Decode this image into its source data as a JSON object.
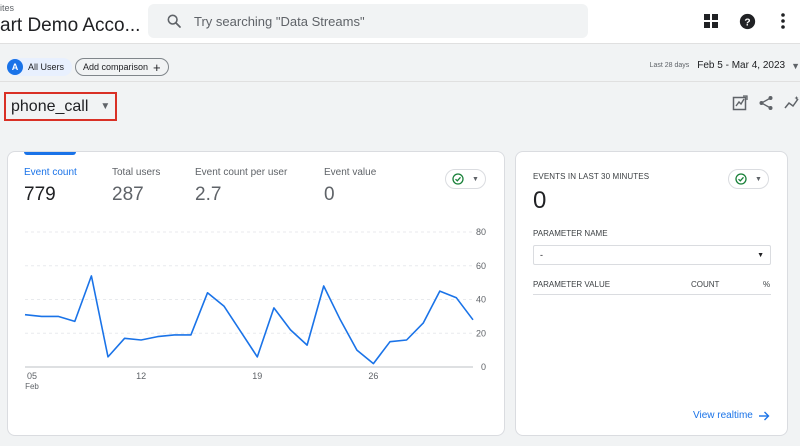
{
  "header": {
    "breadcrumb": "ites",
    "account": "art Demo Acco...",
    "search_placeholder": "Try searching \"Data Streams\"",
    "icons": [
      "apps-grid-icon",
      "help-icon",
      "more-vert-icon"
    ]
  },
  "comparison": {
    "avatar_letter": "A",
    "segment": "All Users",
    "add_label": "Add comparison",
    "date_caption": "Last 28 days",
    "date_range": "Feb 5 - Mar 4, 2023"
  },
  "event": {
    "name": "phone_call",
    "actions": [
      "customize-report-icon",
      "share-icon",
      "insights-icon"
    ]
  },
  "metrics": [
    {
      "label": "Event count",
      "value": "779"
    },
    {
      "label": "Total users",
      "value": "287"
    },
    {
      "label": "Event count per user",
      "value": "2.7"
    },
    {
      "label": "Event value",
      "value": "0"
    }
  ],
  "chart_data": {
    "type": "line",
    "title": "",
    "x_ticks": [
      "05",
      "12",
      "19",
      "26"
    ],
    "x_tick_sub": "Feb",
    "y_ticks": [
      "80",
      "60",
      "40",
      "20",
      "0"
    ],
    "ylim": [
      0,
      80
    ],
    "grid": true,
    "series": [
      {
        "color": "#1a73e8",
        "values": [
          31,
          30,
          30,
          27,
          54,
          6,
          17,
          16,
          18,
          19,
          19,
          44,
          36,
          21,
          6,
          35,
          22,
          13,
          48,
          28,
          10,
          2,
          15,
          16,
          26,
          45,
          41,
          28
        ]
      }
    ]
  },
  "realtime": {
    "title": "EVENTS IN LAST 30 MINUTES",
    "value": "0",
    "param_label": "PARAMETER NAME",
    "param_selected": "-",
    "col_value": "PARAMETER VALUE",
    "col_count": "COUNT",
    "col_pct": "%",
    "link": "View realtime"
  },
  "colors": {
    "accent": "#1a73e8",
    "highlight": "#d93025",
    "check": "#188038"
  }
}
